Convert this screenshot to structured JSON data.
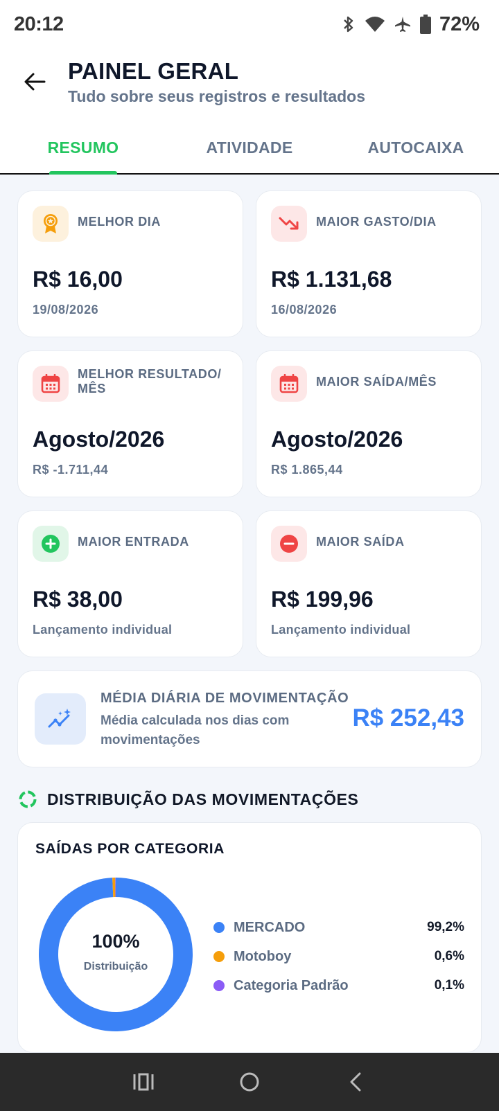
{
  "status_bar": {
    "time": "20:12",
    "battery": "72%",
    "icons": [
      "bluetooth-icon",
      "wifi-icon",
      "airplane-icon",
      "battery-icon"
    ]
  },
  "header": {
    "title": "PAINEL GERAL",
    "subtitle": "Tudo sobre seus registros e resultados"
  },
  "tabs": [
    {
      "label": "RESUMO",
      "active": true
    },
    {
      "label": "ATIVIDADE",
      "active": false
    },
    {
      "label": "AUTOCAIXA",
      "active": false
    }
  ],
  "stats": [
    {
      "label": "MELHOR DIA",
      "value": "R$ 16,00",
      "sub": "19/08/2026",
      "icon": "medal-icon",
      "icon_color": "#f59e0b",
      "icon_bg": "#fdf1dd"
    },
    {
      "label": "MAIOR GASTO/DIA",
      "value": "R$ 1.131,68",
      "sub": "16/08/2026",
      "icon": "trending-down-icon",
      "icon_color": "#ef4444",
      "icon_bg": "#fde7e7"
    },
    {
      "label": "MELHOR RESULTADO/ MÊS",
      "value": "Agosto/2026",
      "sub": "R$ -1.711,44",
      "icon": "calendar-icon",
      "icon_color": "#ef4444",
      "icon_bg": "#fde7e7"
    },
    {
      "label": "MAIOR SAÍDA/MÊS",
      "value": "Agosto/2026",
      "sub": "R$ 1.865,44",
      "icon": "calendar-icon",
      "icon_color": "#ef4444",
      "icon_bg": "#fde7e7"
    },
    {
      "label": "MAIOR ENTRADA",
      "value": "R$ 38,00",
      "sub": "Lançamento individual",
      "icon": "plus-circle-icon",
      "icon_color": "#22c55e",
      "icon_bg": "#e1f6e8"
    },
    {
      "label": "MAIOR SAÍDA",
      "value": "R$ 199,96",
      "sub": "Lançamento individual",
      "icon": "minus-circle-icon",
      "icon_color": "#ef4444",
      "icon_bg": "#fde7e7"
    }
  ],
  "average": {
    "title": "MÉDIA DIÁRIA DE MOVIMENTAÇÃO",
    "description": "Média calculada nos dias com movimentações",
    "value": "R$ 252,43",
    "icon": "chart-sparkle-icon",
    "color": "#3b82f6"
  },
  "distribution": {
    "section_title": "DISTRIBUIÇÃO DAS MOVIMENTAÇÕES",
    "section_icon": "donut-icon",
    "card_title": "SAÍDAS POR CATEGORIA",
    "center_value": "100%",
    "center_caption": "Distribuição",
    "categories": [
      {
        "name": "MERCADO",
        "percent_label": "99,2%",
        "percent": 99.2,
        "color": "#3b82f6"
      },
      {
        "name": "Motoboy",
        "percent_label": "0,6%",
        "percent": 0.6,
        "color": "#f59e0b"
      },
      {
        "name": "Categoria Padrão",
        "percent_label": "0,1%",
        "percent": 0.1,
        "color": "#8b5cf6"
      }
    ]
  },
  "nav_bar": {
    "icons": [
      "recent-apps-icon",
      "home-icon",
      "back-icon"
    ]
  },
  "colors": {
    "accent": "#22c55e",
    "primary_blue": "#3b82f6",
    "danger": "#ef4444"
  }
}
